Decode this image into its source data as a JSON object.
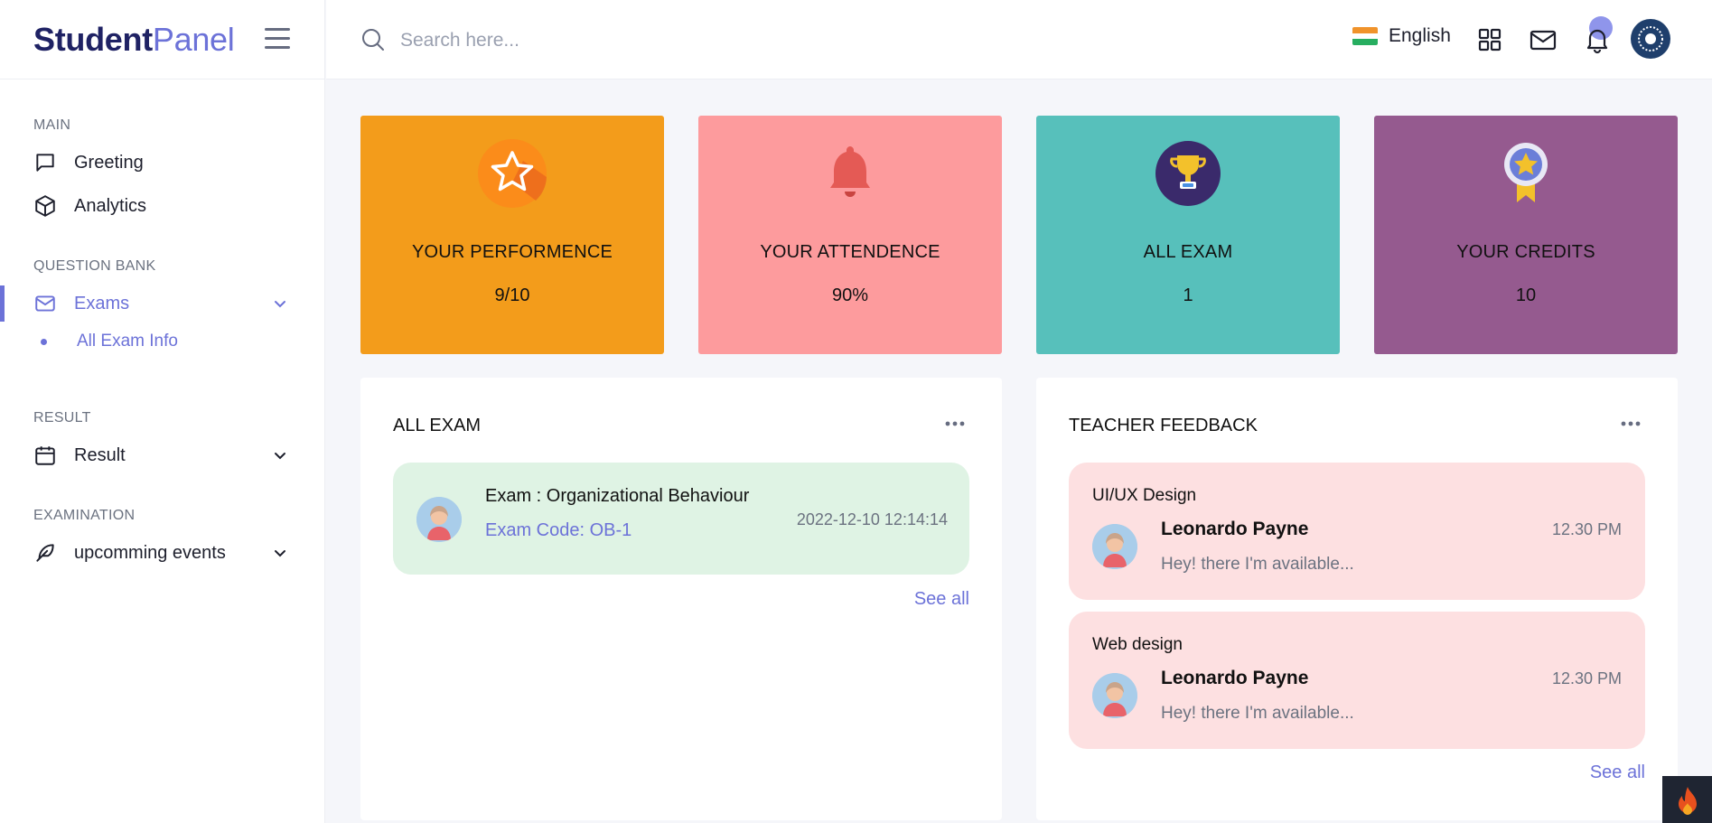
{
  "brand": {
    "strong": "Student",
    "light": "Panel"
  },
  "sidebar": {
    "sections": [
      {
        "label": "MAIN"
      },
      {
        "label": "QUESTION BANK"
      },
      {
        "label": "RESULT"
      },
      {
        "label": "EXAMINATION"
      }
    ],
    "items": [
      {
        "label": "Greeting",
        "icon": "chat-icon"
      },
      {
        "label": "Analytics",
        "icon": "cube-icon"
      },
      {
        "label": "Exams",
        "icon": "mail-icon"
      },
      {
        "label": "Result",
        "icon": "calendar-icon"
      },
      {
        "label": "upcomming events",
        "icon": "feather-icon"
      }
    ],
    "sub_items": [
      {
        "label": "All Exam Info"
      }
    ]
  },
  "topbar": {
    "search_placeholder": "Search here...",
    "language": "English"
  },
  "stats": [
    {
      "title": "YOUR PERFORMENCE",
      "value": "9/10",
      "color": "#f39c1b",
      "icon": "star-icon"
    },
    {
      "title": "YOUR ATTENDENCE",
      "value": "90%",
      "color": "#fd9b9d",
      "icon": "bell-icon"
    },
    {
      "title": "ALL EXAM",
      "value": "1",
      "color": "#57c0bb",
      "icon": "trophy-icon"
    },
    {
      "title": "YOUR CREDITS",
      "value": "10",
      "color": "#955a8f",
      "icon": "medal-icon"
    }
  ],
  "all_exam": {
    "title": "ALL EXAM",
    "items": [
      {
        "title": "Exam : Organizational Behaviour",
        "code": "Exam Code: OB-1",
        "date": "2022-12-10 12:14:14"
      }
    ],
    "see_all": "See all"
  },
  "teacher_feedback": {
    "title": "TEACHER FEEDBACK",
    "items": [
      {
        "subject": "UI/UX Design",
        "name": "Leonardo Payne",
        "time": "12.30 PM",
        "message": "Hey! there I'm available..."
      },
      {
        "subject": "Web design",
        "name": "Leonardo Payne",
        "time": "12.30 PM",
        "message": "Hey! there I'm available..."
      }
    ],
    "see_all": "See all"
  },
  "colors": {
    "accent": "#6c72d8",
    "brand_dark": "#1f2264",
    "exam_bg": "#dff3e4",
    "feedback_bg": "#fde0e1"
  }
}
